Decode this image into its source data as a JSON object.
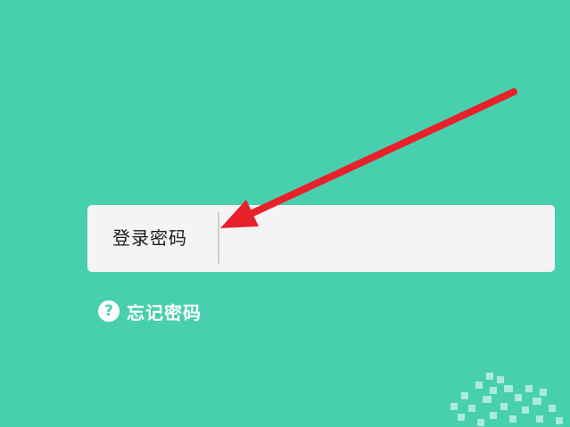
{
  "login": {
    "password_label": "登录密码",
    "password_value": "",
    "password_placeholder": ""
  },
  "forgot": {
    "label": "忘记密码",
    "icon_glyph": "?"
  },
  "colors": {
    "background": "#48d0ae",
    "box": "#f4f4f4",
    "arrow": "#e8202a"
  }
}
